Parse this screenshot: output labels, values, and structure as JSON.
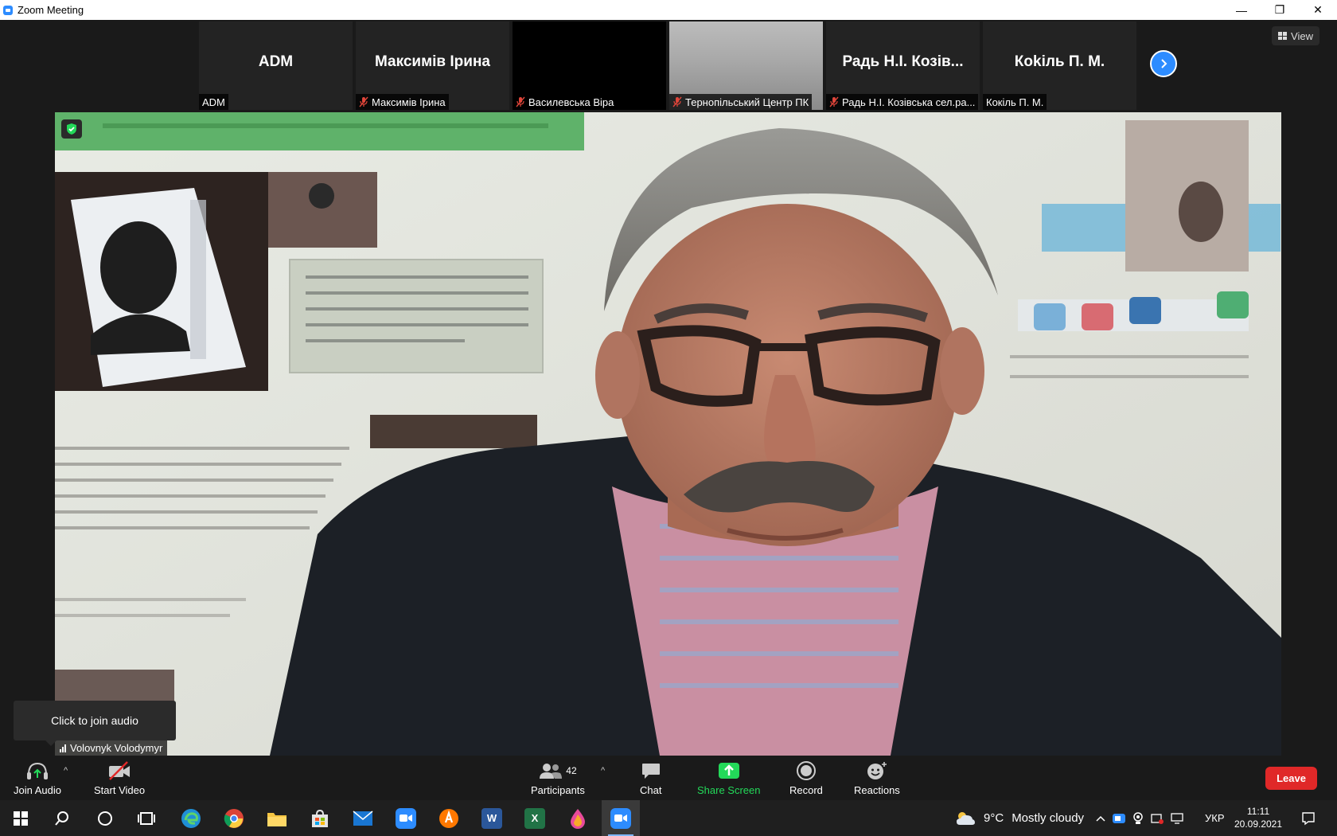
{
  "window": {
    "title": "Zoom Meeting",
    "minimize_glyph": "—",
    "restore_glyph": "❐",
    "close_glyph": "✕"
  },
  "view_button": {
    "label": "View"
  },
  "thumbnails": [
    {
      "big_name": "ADM",
      "label": "ADM",
      "muted": false,
      "style": "dark"
    },
    {
      "big_name": "Максимів Ірина",
      "label": "Максимів Ірина",
      "muted": true,
      "style": "dark"
    },
    {
      "big_name": "",
      "label": "Василевська Віра",
      "muted": true,
      "style": "black"
    },
    {
      "big_name": "",
      "label": "Тернопільський Центр ПК",
      "muted": true,
      "style": "gray"
    },
    {
      "big_name": "Радь Н.І. Козів...",
      "label": "Радь Н.І. Козівська сел.ра...",
      "muted": true,
      "style": "dark"
    },
    {
      "big_name": "Коkіль П. М.",
      "label": "Кокіль П. М.",
      "muted": false,
      "style": "dark"
    }
  ],
  "main_video": {
    "speaker_name": "Volovnyk Volodymyr"
  },
  "tooltip": {
    "text": "Click to join audio"
  },
  "toolbar": {
    "join_audio": "Join Audio",
    "start_video": "Start Video",
    "participants": "Participants",
    "participants_count": "42",
    "chat": "Chat",
    "share_screen": "Share Screen",
    "record": "Record",
    "reactions": "Reactions",
    "leave": "Leave",
    "caret": "^"
  },
  "taskbar": {
    "weather_temp": "9°C",
    "weather_text": "Mostly cloudy",
    "language": "УКР",
    "time": "11:11",
    "date": "20.09.2021",
    "word_letter": "W",
    "excel_letter": "X"
  },
  "colors": {
    "accent_blue": "#2d8cff",
    "share_green": "#23d959",
    "leave_red": "#e02828",
    "muted_red": "#e0453a"
  }
}
